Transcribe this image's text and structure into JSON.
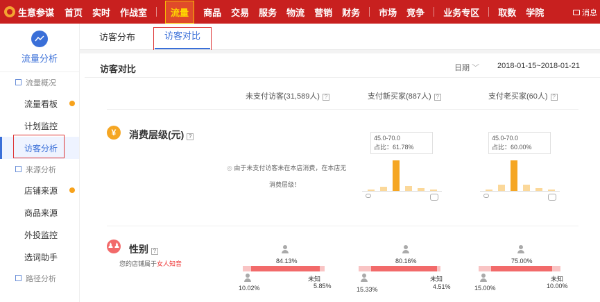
{
  "topnav": {
    "brand": "生意参谋",
    "items": [
      "首页",
      "实时",
      "作战室",
      "流量",
      "商品",
      "交易",
      "服务",
      "物流",
      "营销",
      "财务",
      "市场",
      "竞争",
      "业务专区",
      "取数",
      "学院"
    ],
    "message": "消息",
    "active": "流量"
  },
  "sidebar": {
    "title": "流量分析",
    "groups": [
      {
        "label": "流量概况",
        "items": [
          {
            "label": "流量看板",
            "dot": true
          },
          {
            "label": "计划监控",
            "dot": false
          },
          {
            "label": "访客分析",
            "dot": false,
            "active": true
          }
        ]
      },
      {
        "label": "来源分析",
        "items": [
          {
            "label": "店铺来源",
            "dot": true
          },
          {
            "label": "商品来源",
            "dot": false
          },
          {
            "label": "外投监控",
            "dot": false
          },
          {
            "label": "选词助手",
            "dot": false
          }
        ]
      },
      {
        "label": "路径分析",
        "items": []
      }
    ]
  },
  "tabs": [
    {
      "label": "访客分布"
    },
    {
      "label": "访客对比",
      "active": true
    }
  ],
  "panel": {
    "title": "访客对比",
    "date_label": "日期",
    "date_range": "2018-01-15~2018-01-21",
    "columns": [
      "未支付访客(31,589人)",
      "支付新买家(887人)",
      "支付老买家(60人)"
    ]
  },
  "consumption": {
    "title": "消费层级(元)",
    "note_line1": "由于未支付访客未在本店消费，在本店无",
    "note_line2": "消费层级！",
    "new_buyer": {
      "range": "45.0-70.0",
      "share": "占比：61.78%",
      "values": [
        2,
        8,
        61.78,
        10,
        6,
        2
      ]
    },
    "old_buyer": {
      "range": "45.0-70.0",
      "share": "占比：60.00%",
      "values": [
        3,
        12,
        60.0,
        12,
        5,
        2
      ]
    },
    "color_main": "#f5a623",
    "color_light": "#fbd89a"
  },
  "gender": {
    "title": "性别",
    "subtitle_prefix": "您的店铺属于",
    "subtitle_highlight": "女人知音",
    "groups": [
      {
        "female": "84.13%",
        "male": "10.02%",
        "unknown_label": "未知",
        "unknown": "5.85%",
        "female_v": 84.13,
        "male_v": 10.02,
        "unknown_v": 5.85
      },
      {
        "female": "80.16%",
        "male": "15.33%",
        "unknown_label": "未知",
        "unknown": "4.51%",
        "female_v": 80.16,
        "male_v": 15.33,
        "unknown_v": 4.51
      },
      {
        "female": "75.00%",
        "male": "15.00%",
        "unknown_label": "未知",
        "unknown": "10.00%",
        "female_v": 75.0,
        "male_v": 15.0,
        "unknown_v": 10.0
      }
    ],
    "color_female": "#f26a6a",
    "color_light": "#f9c4c4"
  }
}
